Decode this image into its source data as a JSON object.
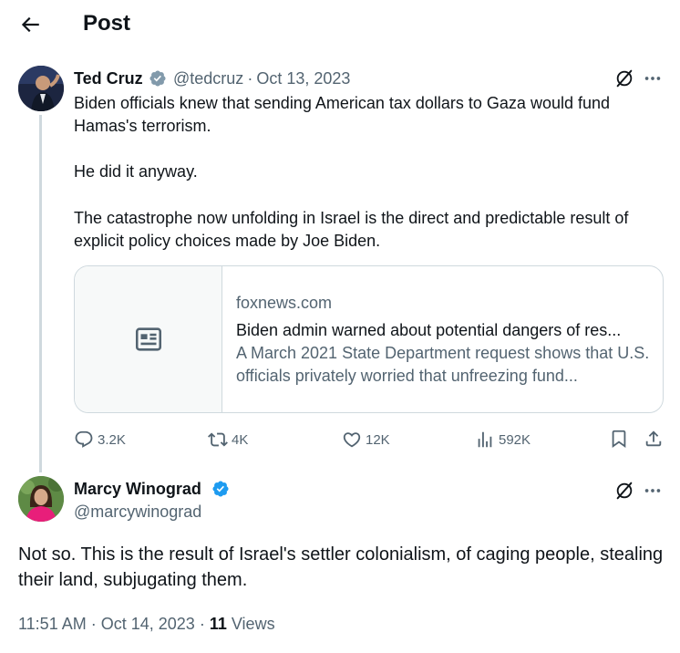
{
  "header": {
    "title": "Post"
  },
  "original_tweet": {
    "display_name": "Ted Cruz",
    "handle": "@tedcruz",
    "date": "Oct 13, 2023",
    "paragraphs": [
      "Biden officials knew that sending American tax dollars to Gaza would fund Hamas's terrorism.",
      "He did it anyway.",
      "The catastrophe now unfolding in Israel is the direct and predictable result of explicit policy choices made by Joe Biden."
    ],
    "link_card": {
      "domain": "foxnews.com",
      "title": "Biden admin warned about potential dangers of res...",
      "description": "A March 2021 State Department request shows that U.S. officials privately worried that unfreezing fund..."
    },
    "stats": {
      "replies": "3.2K",
      "reposts": "4K",
      "likes": "12K",
      "views": "592K"
    }
  },
  "reply_tweet": {
    "display_name": "Marcy Winograd",
    "handle": "@marcywinograd",
    "text": "Not so. This is the result of Israel's settler colonialism, of caging people, stealing their land, subjugating them.",
    "time": "11:51 AM",
    "date": "Oct 14, 2023",
    "views_count": "11",
    "views_label": "Views"
  },
  "colors": {
    "verified_badge": "#1d9bf0",
    "muted_text": "#536471",
    "border": "#cfd9de"
  },
  "icons": [
    "back-arrow-icon",
    "verified-badge-icon",
    "grok-icon",
    "more-icon",
    "news-article-icon",
    "reply-icon",
    "repost-icon",
    "like-icon",
    "views-icon",
    "bookmark-icon",
    "share-icon"
  ]
}
